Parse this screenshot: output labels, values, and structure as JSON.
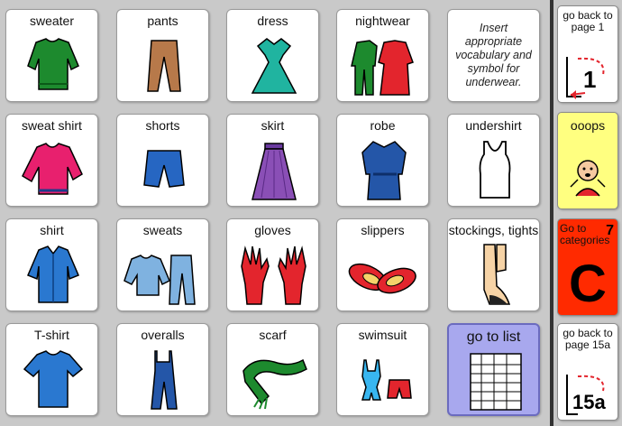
{
  "cells": [
    {
      "label": "sweater",
      "icon": "sweater-icon"
    },
    {
      "label": "pants",
      "icon": "pants-icon"
    },
    {
      "label": "dress",
      "icon": "dress-icon"
    },
    {
      "label": "nightwear",
      "icon": "nightwear-icon"
    },
    {
      "note": "Insert appropriate vocabulary and symbol for underwear."
    },
    {
      "label": "sweat shirt",
      "icon": "sweatshirt-icon"
    },
    {
      "label": "shorts",
      "icon": "shorts-icon"
    },
    {
      "label": "skirt",
      "icon": "skirt-icon"
    },
    {
      "label": "robe",
      "icon": "robe-icon"
    },
    {
      "label": "undershirt",
      "icon": "undershirt-icon"
    },
    {
      "label": "shirt",
      "icon": "shirt-icon"
    },
    {
      "label": "sweats",
      "icon": "sweats-icon"
    },
    {
      "label": "gloves",
      "icon": "gloves-icon"
    },
    {
      "label": "slippers",
      "icon": "slippers-icon"
    },
    {
      "label": "stockings, tights",
      "icon": "stockings-icon"
    },
    {
      "label": "T-shirt",
      "icon": "tshirt-icon"
    },
    {
      "label": "overalls",
      "icon": "overalls-icon"
    },
    {
      "label": "scarf",
      "icon": "scarf-icon"
    },
    {
      "label": "swimsuit",
      "icon": "swimsuit-icon"
    },
    {
      "label": "go to list",
      "icon": "list-icon"
    }
  ],
  "sidebar": {
    "back1": {
      "label": "go back to page 1",
      "page": "1",
      "color": "#ffffff"
    },
    "ooops": {
      "label": "ooops",
      "color": "#ffff80"
    },
    "categories": {
      "label": "Go to categories",
      "number": "7",
      "letter": "C",
      "color": "#ff2a00"
    },
    "back15a": {
      "label": "go back to page 15a",
      "page": "15a",
      "color": "#ffffff"
    }
  }
}
